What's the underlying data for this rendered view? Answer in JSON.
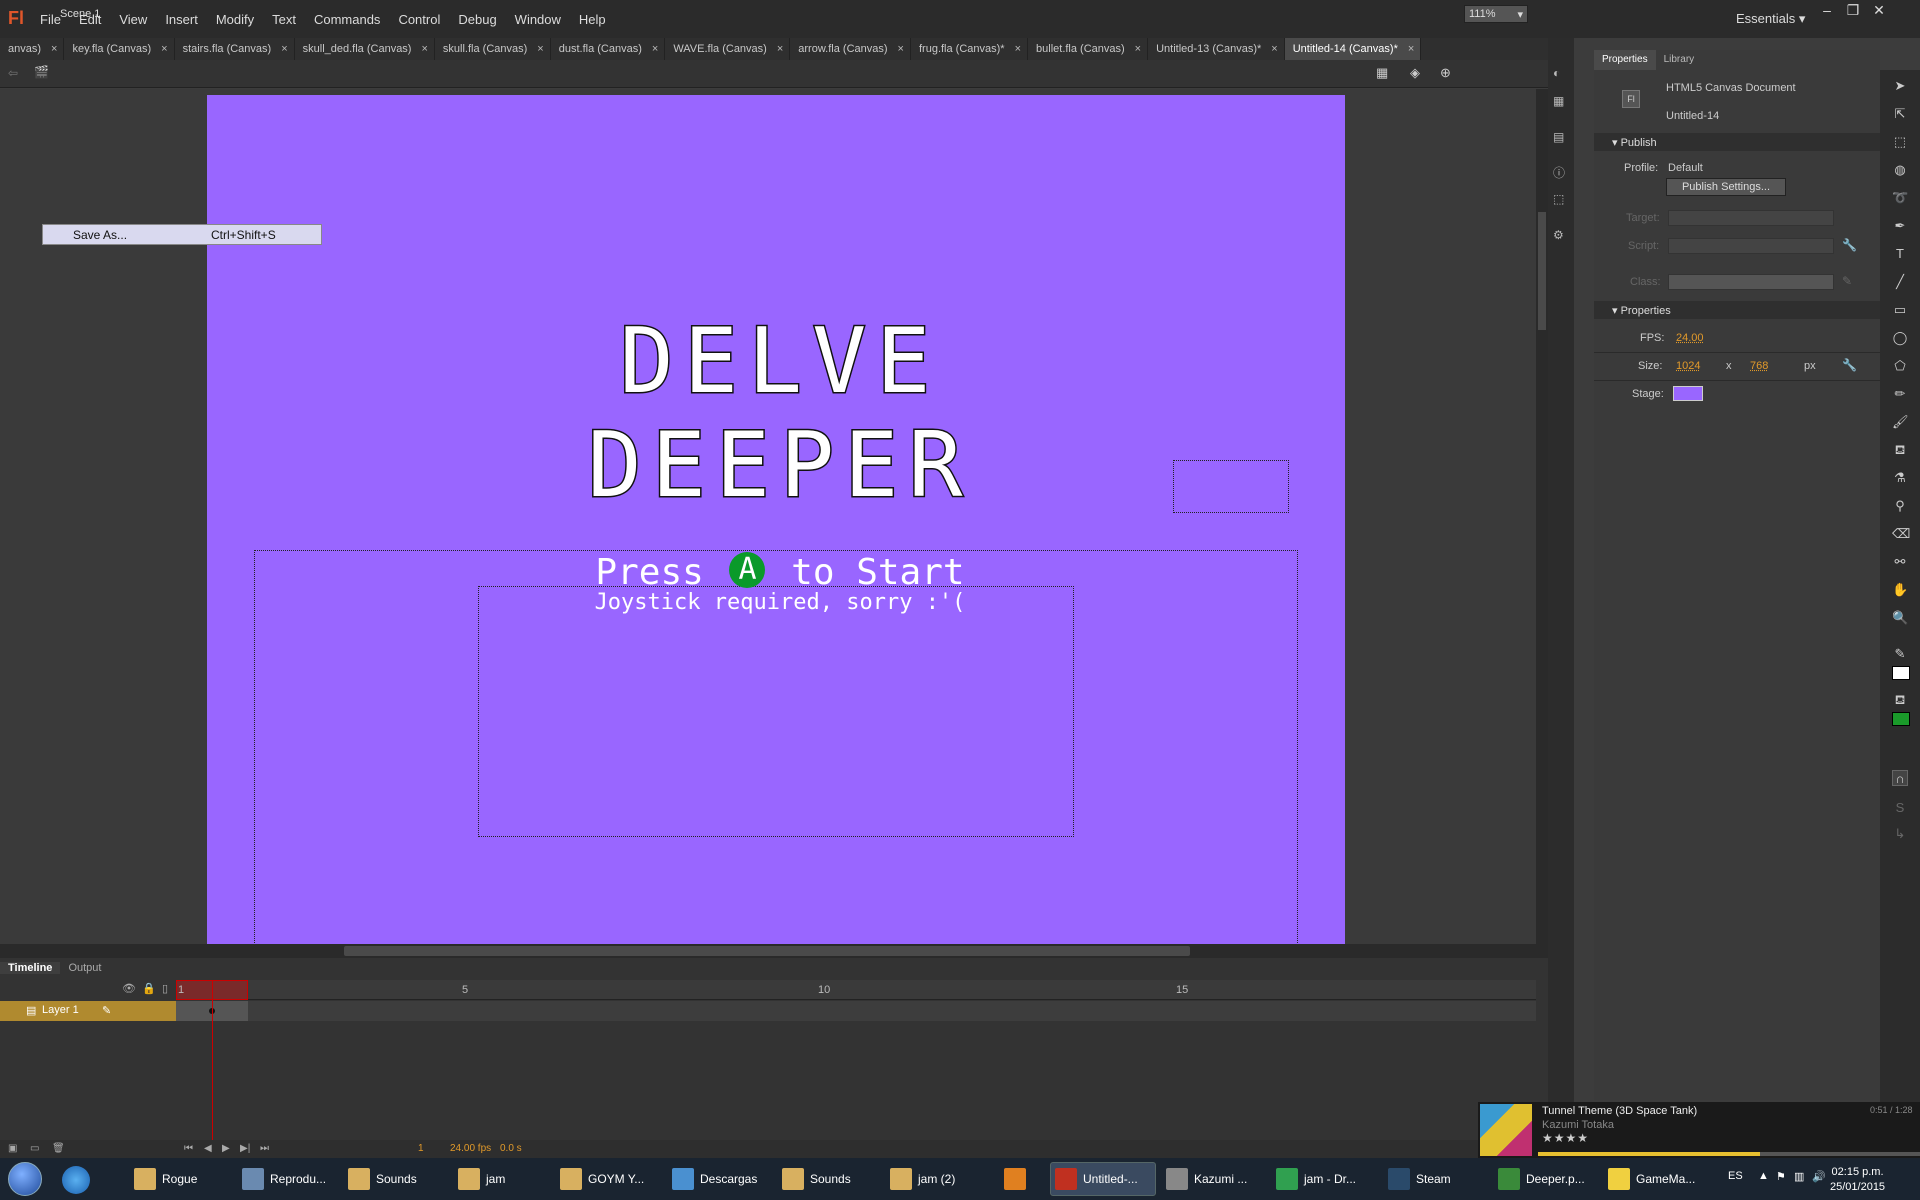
{
  "app": {
    "logo": "Fl",
    "workspace": "Essentials"
  },
  "menu": [
    "File",
    "Edit",
    "View",
    "Insert",
    "Modify",
    "Text",
    "Commands",
    "Control",
    "Debug",
    "Window",
    "Help"
  ],
  "doc_tabs": [
    {
      "label": "anvas)",
      "active": false
    },
    {
      "label": "key.fla (Canvas)",
      "active": false
    },
    {
      "label": "stairs.fla (Canvas)",
      "active": false
    },
    {
      "label": "skull_ded.fla (Canvas)",
      "active": false
    },
    {
      "label": "skull.fla (Canvas)",
      "active": false
    },
    {
      "label": "dust.fla (Canvas)",
      "active": false
    },
    {
      "label": "WAVE.fla (Canvas)",
      "active": false
    },
    {
      "label": "arrow.fla (Canvas)",
      "active": false
    },
    {
      "label": "frug.fla (Canvas)*",
      "active": false
    },
    {
      "label": "bullet.fla (Canvas)",
      "active": false
    },
    {
      "label": "Untitled-13 (Canvas)*",
      "active": false
    },
    {
      "label": "Untitled-14 (Canvas)*",
      "active": true
    }
  ],
  "editbar": {
    "scene": "Scene 1",
    "zoom": "111%"
  },
  "popup": {
    "label": "Save As...",
    "shortcut": "Ctrl+Shift+S"
  },
  "stage": {
    "title_line1": "DELVE",
    "title_line2": "DEEPER",
    "press_before": "Press",
    "press_button": "A",
    "press_after": "to Start",
    "joystick_note": "Joystick required, sorry :'(",
    "color": "#9966ff"
  },
  "timeline": {
    "tabs": [
      "Timeline",
      "Output"
    ],
    "frame_numbers": [
      "1",
      "5",
      "10",
      "15"
    ],
    "layer_name": "Layer 1",
    "current_frame": "1",
    "fps": "24.00 fps",
    "time": "0.0 s"
  },
  "panel": {
    "tabs": [
      "Properties",
      "Library"
    ],
    "doc_type": "HTML5 Canvas Document",
    "doc_name": "Untitled-14",
    "publish_section": "Publish",
    "profile_label": "Profile:",
    "profile_value": "Default",
    "publish_settings": "Publish Settings...",
    "target_label": "Target:",
    "script_label": "Script:",
    "class_label": "Class:",
    "properties_section": "Properties",
    "fps_label": "FPS:",
    "fps_value": "24.00",
    "size_label": "Size:",
    "width": "1024",
    "x": "x",
    "height": "768",
    "unit": "px",
    "stage_label": "Stage:"
  },
  "music": {
    "title": "Tunnel Theme (3D Space Tank)",
    "artist": "Kazumi Totaka",
    "time": "0:51 / 1:28",
    "stars": "★★★★",
    "progress": 0.58
  },
  "taskbar": [
    {
      "label": "Rogue",
      "color": "#d8b060"
    },
    {
      "label": "Reprodu...",
      "color": "#6a8ab0"
    },
    {
      "label": "Sounds",
      "color": "#d8b060"
    },
    {
      "label": "jam",
      "color": "#d8b060"
    },
    {
      "label": "GOYM Y...",
      "color": "#d8b060"
    },
    {
      "label": "Descargas",
      "color": "#4a90d0"
    },
    {
      "label": "Sounds",
      "color": "#d8b060"
    },
    {
      "label": "jam (2)",
      "color": "#d8b060"
    },
    {
      "label": "",
      "color": "#e08020"
    },
    {
      "label": "Untitled-...",
      "color": "#c03020",
      "active": true
    },
    {
      "label": "Kazumi ...",
      "color": "#888888"
    },
    {
      "label": "jam - Dr...",
      "color": "#30a050"
    },
    {
      "label": "Steam",
      "color": "#2a4a6a"
    },
    {
      "label": "Deeper.p...",
      "color": "#3a8a3a"
    },
    {
      "label": "GameMa...",
      "color": "#f0d040"
    }
  ],
  "tray": {
    "lang": "ES",
    "time": "02:15 p.m.",
    "date": "25/01/2015"
  }
}
